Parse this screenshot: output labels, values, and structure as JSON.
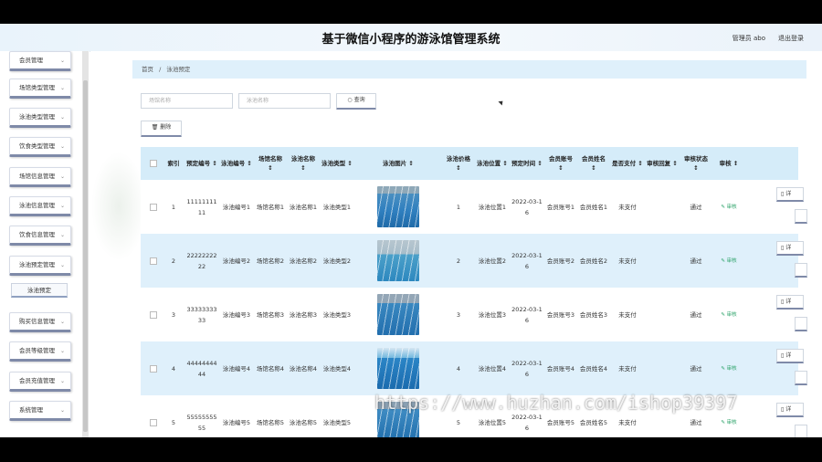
{
  "header": {
    "title": "基于微信小程序的游泳馆管理系统",
    "user_label": "管理员 abo",
    "logout_label": "退出登录"
  },
  "sidebar": {
    "items": [
      {
        "label": "会员管理"
      },
      {
        "label": "场馆类型管理"
      },
      {
        "label": "泳池类型管理"
      },
      {
        "label": "饮食类型管理"
      },
      {
        "label": "场馆信息管理"
      },
      {
        "label": "泳池信息管理"
      },
      {
        "label": "饮食信息管理"
      },
      {
        "label": "泳池预定管理"
      },
      {
        "label": "购买信息管理"
      },
      {
        "label": "会员等级管理"
      },
      {
        "label": "会员充值管理"
      },
      {
        "label": "系统管理"
      }
    ],
    "sub_item": "泳池预定"
  },
  "breadcrumb": {
    "home": "首页",
    "separator": "/",
    "current": "泳池预定"
  },
  "search": {
    "venue_placeholder": "场馆名称",
    "pool_placeholder": "泳池名称",
    "query_label": "查询",
    "delete_label": "删除"
  },
  "table": {
    "headers": {
      "index": "索引",
      "order_no": "预定编号",
      "pool_no": "泳池编号",
      "venue_name": "场馆名称",
      "pool_name": "泳池名称",
      "pool_type": "泳池类型",
      "pool_image": "泳池图片",
      "price": "泳池价格",
      "position": "泳池位置",
      "reserve_time": "预定时间",
      "member_account": "会员账号",
      "member_name": "会员姓名",
      "paid": "是否支付",
      "review_reply": "审核回复",
      "review_status": "审核状态",
      "review": "审核"
    },
    "sort_icon": "↕",
    "rows": [
      {
        "index": "1",
        "order_no": "1111111111",
        "pool_no": "泳池编号1",
        "venue_name": "场馆名称1",
        "pool_name": "泳池名称1",
        "pool_type": "泳池类型1",
        "price": "1",
        "position": "泳池位置1",
        "reserve_time": "2022-03-16",
        "member_account": "会员账号1",
        "member_name": "会员姓名1",
        "paid": "未支付",
        "review_reply": "",
        "review_status": "通过",
        "review_action": "审核",
        "detail": "详"
      },
      {
        "index": "2",
        "order_no": "2222222222",
        "pool_no": "泳池编号2",
        "venue_name": "场馆名称2",
        "pool_name": "泳池名称2",
        "pool_type": "泳池类型2",
        "price": "2",
        "position": "泳池位置2",
        "reserve_time": "2022-03-16",
        "member_account": "会员账号2",
        "member_name": "会员姓名2",
        "paid": "未支付",
        "review_reply": "",
        "review_status": "通过",
        "review_action": "审核",
        "detail": "详"
      },
      {
        "index": "3",
        "order_no": "3333333333",
        "pool_no": "泳池编号3",
        "venue_name": "场馆名称3",
        "pool_name": "泳池名称3",
        "pool_type": "泳池类型3",
        "price": "3",
        "position": "泳池位置3",
        "reserve_time": "2022-03-16",
        "member_account": "会员账号3",
        "member_name": "会员姓名3",
        "paid": "未支付",
        "review_reply": "",
        "review_status": "通过",
        "review_action": "审核",
        "detail": "详"
      },
      {
        "index": "4",
        "order_no": "4444444444",
        "pool_no": "泳池编号4",
        "venue_name": "场馆名称4",
        "pool_name": "泳池名称4",
        "pool_type": "泳池类型4",
        "price": "4",
        "position": "泳池位置4",
        "reserve_time": "2022-03-16",
        "member_account": "会员账号4",
        "member_name": "会员姓名4",
        "paid": "未支付",
        "review_reply": "",
        "review_status": "通过",
        "review_action": "审核",
        "detail": "详"
      },
      {
        "index": "5",
        "order_no": "5555555555",
        "pool_no": "泳池编号5",
        "venue_name": "场馆名称5",
        "pool_name": "泳池名称5",
        "pool_type": "泳池类型5",
        "price": "5",
        "position": "泳池位置5",
        "reserve_time": "2022-03-16",
        "member_account": "会员账号5",
        "member_name": "会员姓名5",
        "paid": "未支付",
        "review_reply": "",
        "review_status": "通过",
        "review_action": "审核",
        "detail": "详"
      }
    ]
  },
  "watermark": "https://www.huzhan.com/ishop39397",
  "colors": {
    "header_bg": "#eaf3fb",
    "table_header_bg": "#d5ecf9",
    "row_alt_bg": "#dff0fb",
    "audit_green": "#2da36a"
  }
}
